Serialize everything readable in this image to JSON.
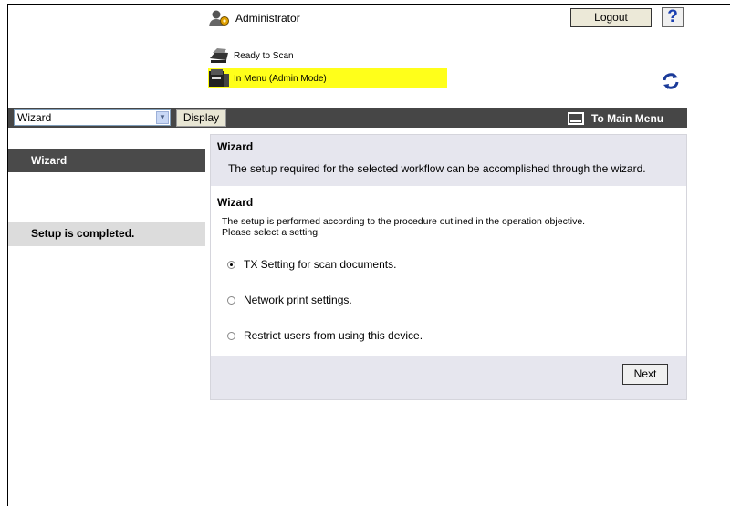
{
  "header": {
    "user_label": "Administrator",
    "logout_label": "Logout",
    "help_label": "?",
    "status_ready": "Ready to Scan",
    "status_menu": "In Menu (Admin Mode)"
  },
  "toolbar": {
    "select_value": "Wizard",
    "display_label": "Display",
    "main_menu_label": "To Main Menu"
  },
  "sidebar": {
    "items": [
      {
        "label": "Wizard"
      },
      {
        "label": "Setup is completed."
      }
    ]
  },
  "panel": {
    "title": "Wizard",
    "description": "The setup required for the selected workflow can be accomplished through the wizard.",
    "section_title": "Wizard",
    "section_desc_line1": "The setup is performed according to the procedure outlined in the operation objective.",
    "section_desc_line2": "Please select a setting.",
    "options": [
      {
        "label": "TX Setting for scan documents.",
        "selected": true
      },
      {
        "label": "Network print settings.",
        "selected": false
      },
      {
        "label": "Restrict users from using this device.",
        "selected": false
      }
    ],
    "next_label": "Next"
  },
  "colors": {
    "topbar": "#464646",
    "status_highlight": "#ffff1a",
    "panel_header": "#e6e6ee",
    "sidebar_active": "#4a4a4a",
    "sidebar_complete": "#dcdcdc"
  },
  "icons": [
    "admin-user-icon",
    "scanner-ready-icon",
    "printer-menu-icon",
    "refresh-icon",
    "main-menu-icon",
    "help-icon",
    "dropdown-arrow-icon"
  ]
}
